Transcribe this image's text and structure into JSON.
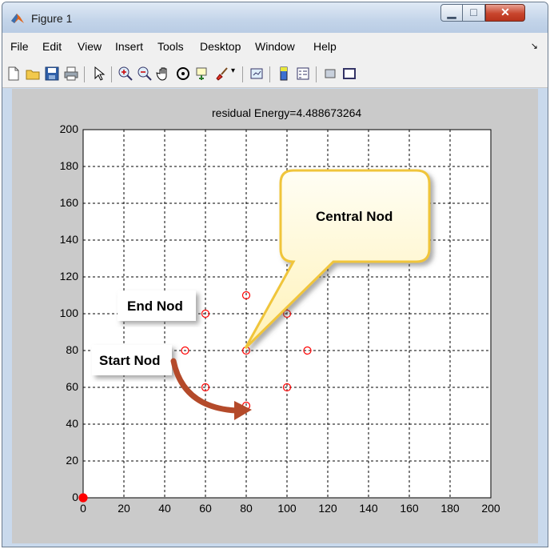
{
  "window": {
    "title": "Figure 1"
  },
  "menu": [
    "File",
    "Edit",
    "View",
    "Insert",
    "Tools",
    "Desktop",
    "Window",
    "Help"
  ],
  "toolbar_icons": [
    "new-figure-icon",
    "open-file-icon",
    "save-icon",
    "print-icon",
    "pointer-icon",
    "zoom-in-icon",
    "zoom-out-icon",
    "pan-icon",
    "rotate-3d-icon",
    "data-cursor-icon",
    "brush-icon",
    "link-plot-icon",
    "colorbar-icon",
    "legend-icon",
    "hide-plot-tools-icon",
    "show-plot-tools-icon"
  ],
  "chart_data": {
    "type": "scatter",
    "title": "residual Energy=4.488673264",
    "xlim": [
      0,
      200
    ],
    "ylim": [
      0,
      200
    ],
    "xticks": [
      0,
      20,
      40,
      60,
      80,
      100,
      120,
      140,
      160,
      180,
      200
    ],
    "yticks": [
      0,
      20,
      40,
      60,
      80,
      100,
      120,
      140,
      160,
      180,
      200
    ],
    "grid": true,
    "series": [
      {
        "marker": "open-circle",
        "color": "#ff0000",
        "x": [
          80,
          60,
          100,
          50,
          80,
          110,
          60,
          100,
          80
        ],
        "y": [
          110,
          100,
          100,
          80,
          80,
          80,
          60,
          60,
          50
        ]
      },
      {
        "marker": "filled-circle",
        "color": "#ff0000",
        "x": [
          0
        ],
        "y": [
          0
        ]
      }
    ]
  },
  "annotations": {
    "central": "Central Nod",
    "end": "End Nod",
    "start": "Start Nod"
  }
}
